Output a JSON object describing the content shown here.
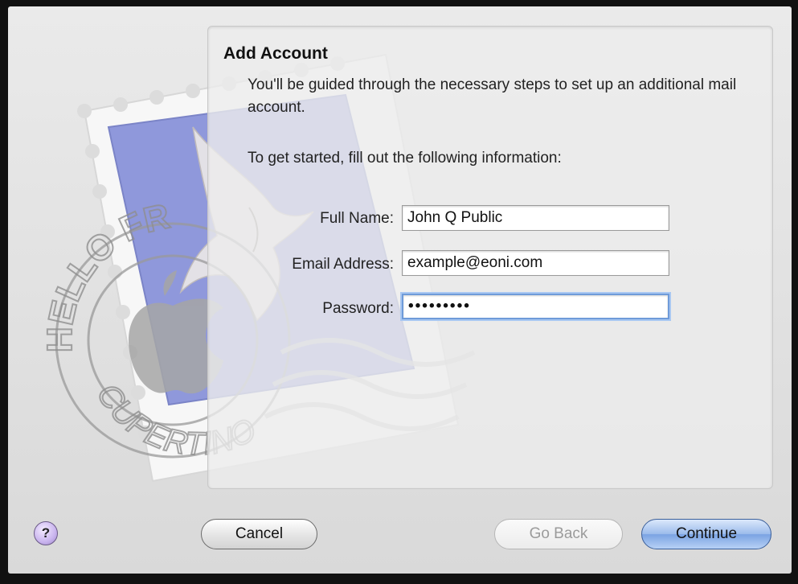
{
  "dialog": {
    "title": "Add Account",
    "intro": "You'll be guided through the necessary steps to set up an additional mail account.",
    "instruction": "To get started, fill out the following information:"
  },
  "form": {
    "full_name": {
      "label": "Full Name:",
      "value": "John Q Public"
    },
    "email": {
      "label": "Email Address:",
      "value": "example@eoni.com"
    },
    "password": {
      "label": "Password:",
      "value": "•••••••••"
    }
  },
  "stamp": {
    "text_top": "HELLO FR",
    "text_bottom": "CUPERTINO CA"
  },
  "buttons": {
    "help": "?",
    "cancel": "Cancel",
    "go_back": "Go Back",
    "continue": "Continue"
  },
  "icons": [
    "mail-stamp-icon",
    "eagle-icon",
    "apple-logo-icon",
    "help-icon"
  ]
}
